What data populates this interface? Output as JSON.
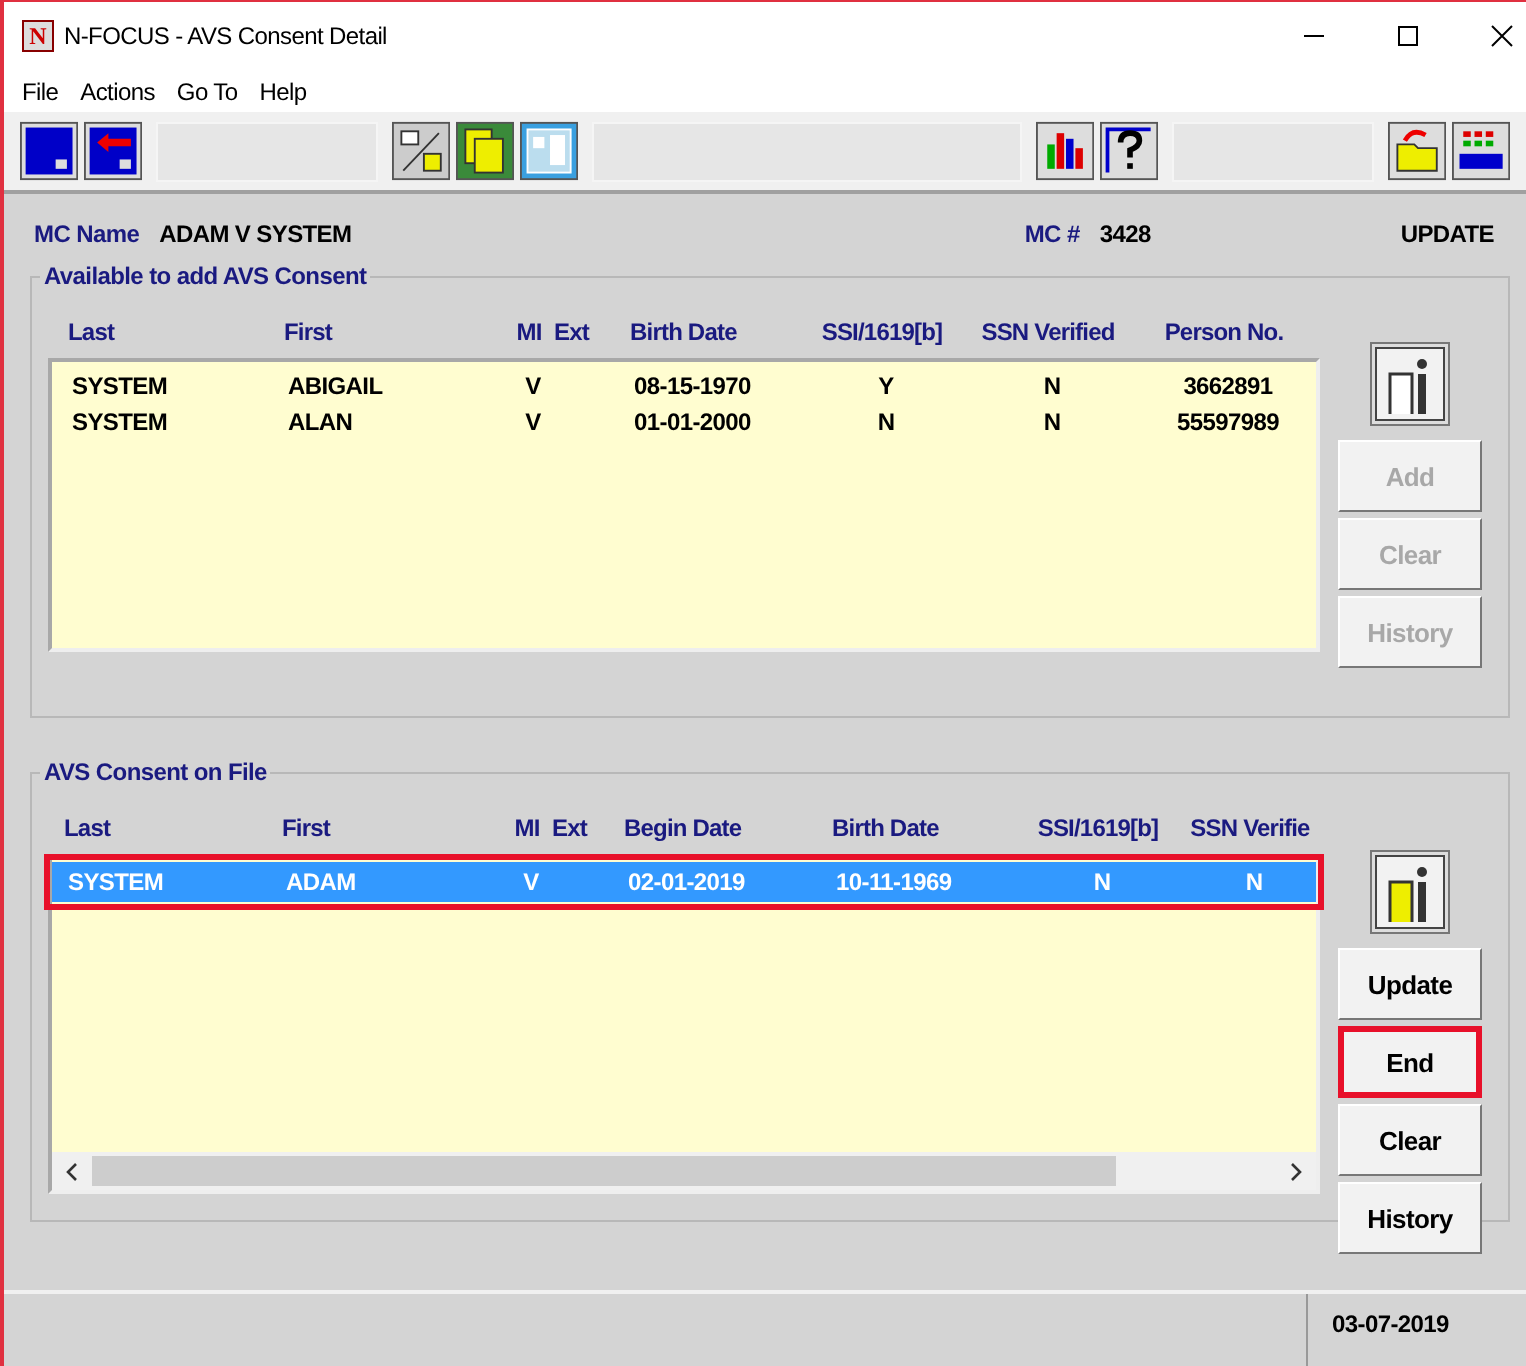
{
  "window": {
    "title": "N-FOCUS - AVS Consent Detail",
    "app_icon_letter": "N"
  },
  "menu": [
    "File",
    "Actions",
    "Go To",
    "Help"
  ],
  "header": {
    "name_label": "MC Name",
    "name_value": "ADAM V SYSTEM",
    "number_label": "MC #",
    "number_value": "3428",
    "mode": "UPDATE"
  },
  "available": {
    "title": "Available to add AVS Consent",
    "columns": [
      "Last",
      "First",
      "MI",
      "Ext",
      "Birth Date",
      "SSI/1619[b]",
      "SSN Verified",
      "Person No."
    ],
    "rows": [
      {
        "cells": [
          "SYSTEM",
          "ABIGAIL",
          "V",
          "",
          "08-15-1970",
          "Y",
          "N",
          "3662891"
        ]
      },
      {
        "cells": [
          "SYSTEM",
          "ALAN",
          "V",
          "",
          "01-01-2000",
          "N",
          "N",
          "55597989"
        ]
      }
    ],
    "buttons": [
      {
        "label": "Add",
        "disabled": true
      },
      {
        "label": "Clear",
        "disabled": true
      },
      {
        "label": "History",
        "disabled": true
      }
    ]
  },
  "on_file": {
    "title": "AVS Consent on File",
    "columns": [
      "Last",
      "First",
      "MI",
      "Ext",
      "Begin Date",
      "Birth Date",
      "SSI/1619[b]",
      "SSN Verifie"
    ],
    "rows": [
      {
        "cells": [
          "SYSTEM",
          "ADAM",
          "V",
          "",
          "02-01-2019",
          "10-11-1969",
          "N",
          "N"
        ],
        "selected": true,
        "highlighted": true
      }
    ],
    "buttons": [
      {
        "label": "Update",
        "disabled": false,
        "highlighted": false
      },
      {
        "label": "End",
        "disabled": false,
        "highlighted": true
      },
      {
        "label": "Clear",
        "disabled": false,
        "highlighted": false
      },
      {
        "label": "History",
        "disabled": false,
        "highlighted": false
      }
    ]
  },
  "status_bar": {
    "date": "03-07-2019"
  }
}
